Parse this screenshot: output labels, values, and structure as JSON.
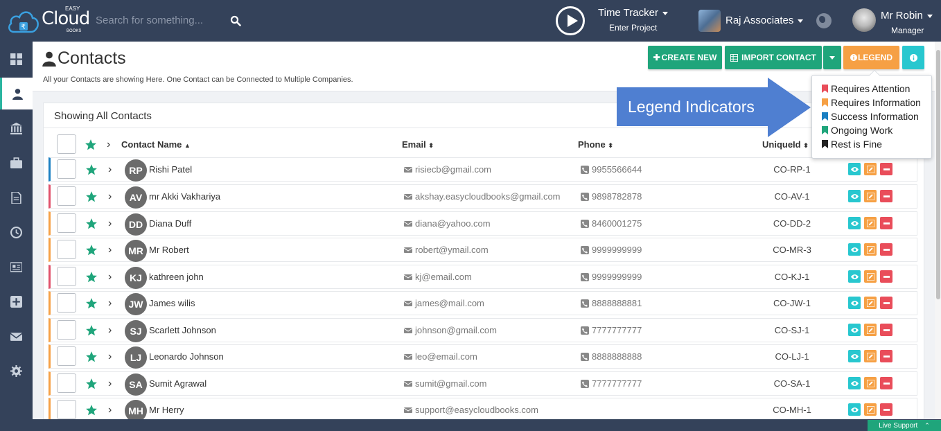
{
  "topbar": {
    "logo": {
      "brand": "Cloud",
      "easy": "EASY",
      "books": "BOOKS"
    },
    "search_placeholder": "Search for something...",
    "time_tracker": {
      "title": "Time Tracker",
      "subtitle": "Enter Project"
    },
    "company": "Raj Associates",
    "user": {
      "name": "Mr Robin",
      "role": "Manager"
    }
  },
  "sidebar": {
    "items": [
      {
        "icon": "dashboard-icon"
      },
      {
        "icon": "user-icon",
        "active": true
      },
      {
        "icon": "bank-icon"
      },
      {
        "icon": "briefcase-icon"
      },
      {
        "icon": "document-icon"
      },
      {
        "icon": "clock-icon"
      },
      {
        "icon": "newspaper-icon"
      },
      {
        "icon": "plus-square-icon"
      },
      {
        "icon": "envelope-icon"
      },
      {
        "icon": "gear-icon"
      }
    ]
  },
  "page": {
    "title": "Contacts",
    "subtitle": "All your Contacts are showing Here. One Contact can be Connected to Multiple Companies."
  },
  "actions": {
    "create_new": "CREATE NEW",
    "import_contact": "IMPORT CONTACT",
    "legend": "LEGEND"
  },
  "card": {
    "title": "Showing All Contacts",
    "columns": {
      "name": "Contact Name",
      "email": "Email",
      "phone": "Phone",
      "uid": "UniqueId"
    }
  },
  "contacts": [
    {
      "initials": "RP",
      "name": "Rishi Patel",
      "email": "risiecb@gmail.com",
      "phone": "9955566644",
      "uid": "CO-RP-1",
      "status_color": "#1a7fc2"
    },
    {
      "initials": "AV",
      "name": "mr Akki Vakhariya",
      "email": "akshay.easycloudbooks@gmail.com",
      "phone": "9898782878",
      "uid": "CO-AV-1",
      "status_color": "#e0506a"
    },
    {
      "initials": "DD",
      "name": "Diana Duff",
      "email": "diana@yahoo.com",
      "phone": "8460001275",
      "uid": "CO-DD-2",
      "status_color": "#f6a044"
    },
    {
      "initials": "MR",
      "name": "Mr Robert",
      "email": "robert@ymail.com",
      "phone": "9999999999",
      "uid": "CO-MR-3",
      "status_color": "#f6a044"
    },
    {
      "initials": "KJ",
      "name": "kathreen john",
      "email": "kj@email.com",
      "phone": "9999999999",
      "uid": "CO-KJ-1",
      "status_color": "#e0506a"
    },
    {
      "initials": "JW",
      "name": "James wilis",
      "email": "james@mail.com",
      "phone": "8888888881",
      "uid": "CO-JW-1",
      "status_color": "#f6a044"
    },
    {
      "initials": "SJ",
      "name": "Scarlett Johnson",
      "email": "johnson@gmail.com",
      "phone": "7777777777",
      "uid": "CO-SJ-1",
      "status_color": "#f6a044"
    },
    {
      "initials": "LJ",
      "name": "Leonardo Johnson",
      "email": "leo@email.com",
      "phone": "8888888888",
      "uid": "CO-LJ-1",
      "status_color": "#f6a044"
    },
    {
      "initials": "SA",
      "name": "Sumit Agrawal",
      "email": "sumit@gmail.com",
      "phone": "7777777777",
      "uid": "CO-SA-1",
      "status_color": "#f6a044"
    },
    {
      "initials": "MH",
      "name": "Mr Herry",
      "email": "support@easycloudbooks.com",
      "phone": "",
      "uid": "CO-MH-1",
      "status_color": "#f6a044"
    }
  ],
  "legend": {
    "items": [
      {
        "label": "Requires Attention",
        "color": "#e94d5a"
      },
      {
        "label": "Requires Information",
        "color": "#f6a044"
      },
      {
        "label": "Success Information",
        "color": "#1a7fc2"
      },
      {
        "label": "Ongoing Work",
        "color": "#1fa57b"
      },
      {
        "label": "Rest is Fine",
        "color": "#222222"
      }
    ]
  },
  "callout": {
    "text": "Legend Indicators"
  },
  "live_support": "Live Support"
}
